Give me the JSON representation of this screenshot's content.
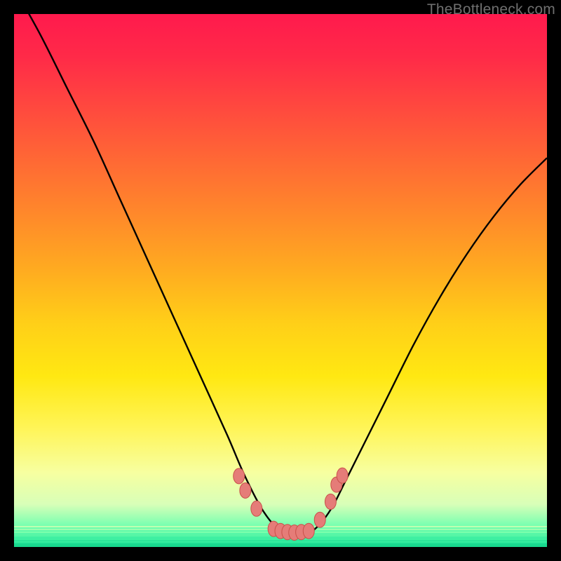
{
  "watermark": "TheBottleneck.com",
  "colors": {
    "frame": "#000000",
    "curve_stroke": "#000000",
    "marker_fill": "#e57c78",
    "marker_stroke": "#c9504a"
  },
  "chart_data": {
    "type": "line",
    "title": "",
    "xlabel": "",
    "ylabel": "",
    "xlim": [
      0,
      100
    ],
    "ylim": [
      0,
      100
    ],
    "grid": false,
    "legend": false,
    "annotations": [],
    "series": [
      {
        "name": "curve",
        "x": [
          0,
          5,
          10,
          15,
          20,
          25,
          30,
          35,
          40,
          43,
          46,
          48,
          50,
          52,
          54,
          56,
          58,
          60,
          62,
          65,
          70,
          75,
          80,
          85,
          90,
          95,
          100
        ],
        "y": [
          105,
          96,
          86,
          76,
          65,
          54,
          43,
          32,
          21,
          14,
          8,
          5,
          3,
          2,
          2,
          3,
          5,
          8,
          12,
          18,
          28,
          38,
          47,
          55,
          62,
          68,
          73
        ]
      }
    ],
    "markers": [
      {
        "x": 42.2,
        "y": 13.3
      },
      {
        "x": 43.4,
        "y": 10.6
      },
      {
        "x": 45.5,
        "y": 7.2
      },
      {
        "x": 48.7,
        "y": 3.4
      },
      {
        "x": 50.0,
        "y": 3.0
      },
      {
        "x": 51.3,
        "y": 2.8
      },
      {
        "x": 52.6,
        "y": 2.7
      },
      {
        "x": 53.9,
        "y": 2.8
      },
      {
        "x": 55.3,
        "y": 3.0
      },
      {
        "x": 57.4,
        "y": 5.1
      },
      {
        "x": 59.4,
        "y": 8.5
      },
      {
        "x": 60.5,
        "y": 11.7
      },
      {
        "x": 61.6,
        "y": 13.4
      }
    ]
  }
}
